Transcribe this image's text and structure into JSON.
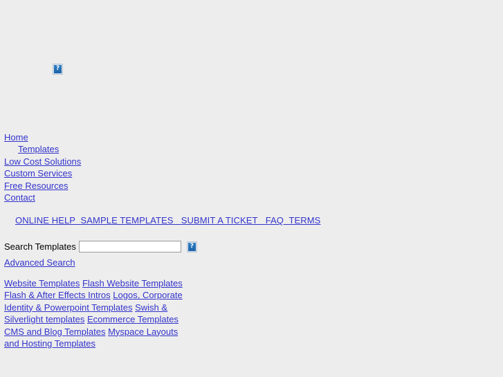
{
  "page": {
    "background_color": "#ededed",
    "link_color": "#3333cc",
    "text_color": "#000000"
  },
  "hero": {
    "image_alt": "broken-image",
    "icon": "broken-image-icon",
    "glyph": "?"
  },
  "primary_nav": {
    "items": [
      {
        "label": "Home",
        "indent": false
      },
      {
        "label": "Templates",
        "indent": true
      },
      {
        "label": "Low Cost Solutions",
        "indent": false
      },
      {
        "label": "Custom Services",
        "indent": false
      },
      {
        "label": "Free Resources",
        "indent": false
      },
      {
        "label": "Contact",
        "indent": false
      }
    ]
  },
  "secondary_nav": {
    "items": [
      {
        "label": "ONLINE HELP"
      },
      {
        "label": "SAMPLE TEMPLATES"
      },
      {
        "label": "SUBMIT A TICKET"
      },
      {
        "label": "FAQ"
      },
      {
        "label": "TERMS"
      }
    ]
  },
  "search": {
    "label": "Search Templates",
    "value": "",
    "placeholder": "",
    "go_icon": "broken-image-icon",
    "go_glyph": "?",
    "advanced_link": "Advanced Search"
  },
  "category_links": {
    "items": [
      {
        "label": "Website "
      },
      {
        "label": "Templates"
      },
      {
        "label": "Flash Website "
      },
      {
        "label": "Templates"
      },
      {
        "label": "Flash & After Effects Intros"
      },
      {
        "label": "Logos, Corporate Identity & Powerpoint Templates"
      },
      {
        "label": "Swish & Silverlight templates"
      },
      {
        "label": "Ecommerce "
      },
      {
        "label": "Templates"
      },
      {
        "label": "CMS and Blog Templates"
      },
      {
        "label": "Myspace Layouts and Hosting Templates"
      }
    ]
  }
}
